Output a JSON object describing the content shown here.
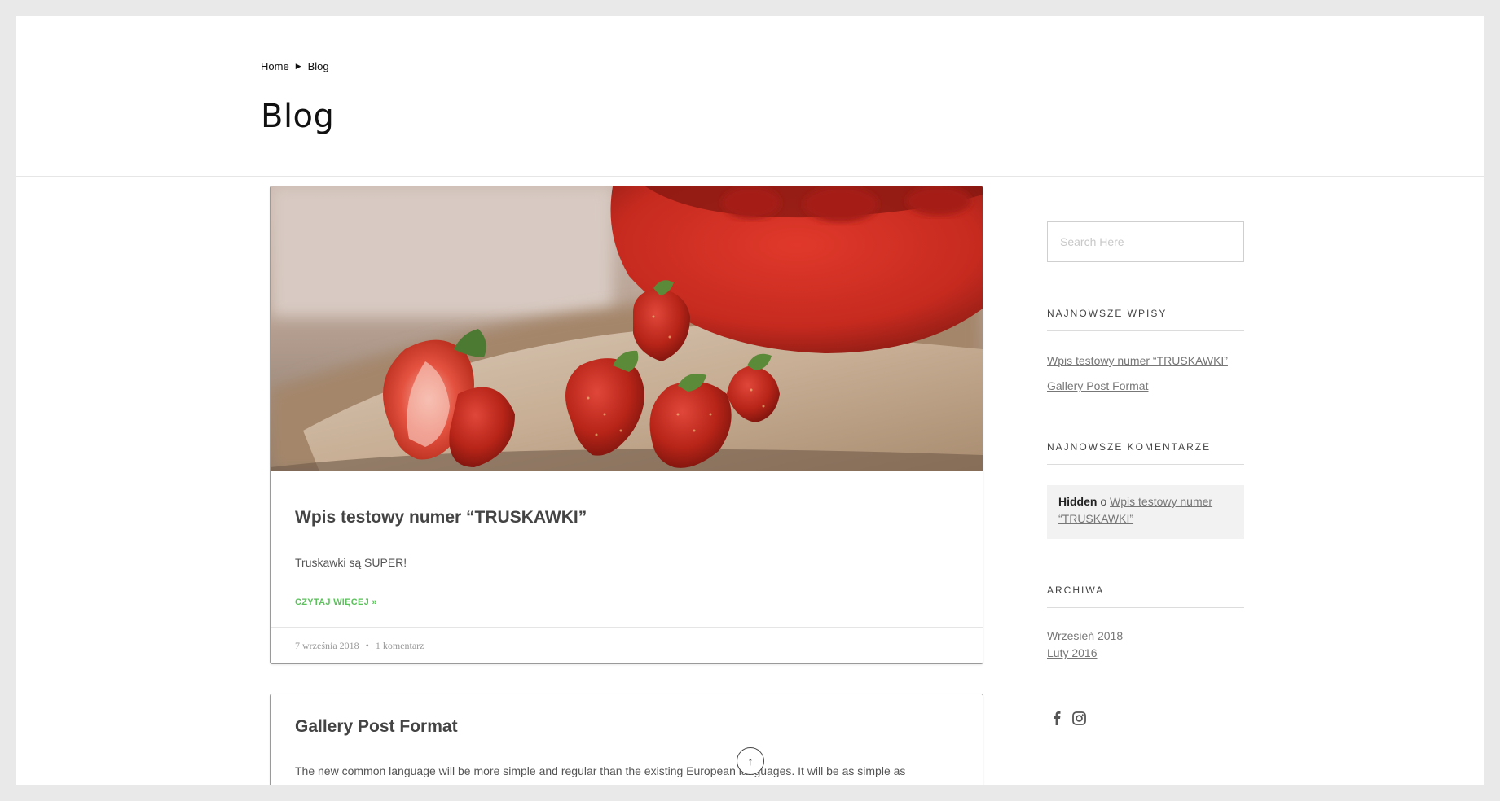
{
  "breadcrumb": {
    "home": "Home",
    "separator": "▶",
    "current": "Blog"
  },
  "page_title": "Blog",
  "posts": [
    {
      "title": "Wpis testowy numer “TRUSKAWKI”",
      "excerpt": "Truskawki są SUPER!",
      "read_more": "CZYTAJ WIĘCEJ »",
      "date": "7 września 2018",
      "meta_separator": "•",
      "comments": "1 komentarz",
      "image": "strawberries-photo"
    },
    {
      "title": "Gallery Post Format",
      "excerpt": "The new common language will be more simple and regular than the existing European languages. It will be as simple as Occidental; in fact, it"
    }
  ],
  "sidebar": {
    "search": {
      "placeholder": "Search Here"
    },
    "recent_posts": {
      "title": "NAJNOWSZE WPISY",
      "items": [
        "Wpis testowy numer “TRUSKAWKI”",
        "Gallery Post Format"
      ]
    },
    "recent_comments": {
      "title": "NAJNOWSZE KOMENTARZE",
      "author": "Hidden",
      "connector": "o",
      "post": "Wpis testowy numer “TRUSKAWKI”"
    },
    "archives": {
      "title": "ARCHIWA",
      "items": [
        "Wrzesień 2018",
        "Luty 2016"
      ]
    },
    "social": [
      "facebook-icon",
      "instagram-icon"
    ]
  },
  "scroll_top": {
    "icon": "↑"
  },
  "colors": {
    "accent": "#5cc05c",
    "page_bg": "#e9e9e9",
    "comment_bg": "#f2f2f2"
  }
}
